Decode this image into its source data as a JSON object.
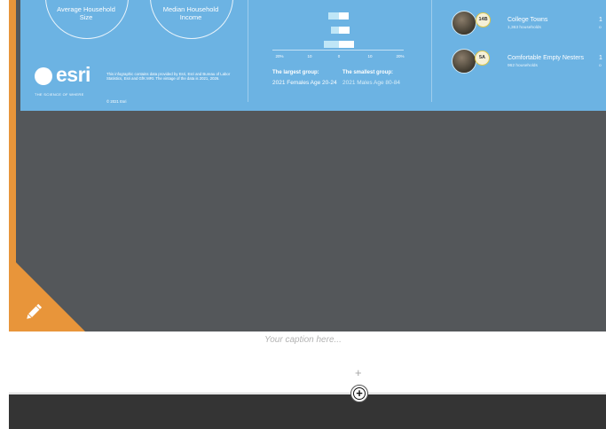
{
  "infographic": {
    "household_size_label": "Average Household Size",
    "income_label": "Median Household Income",
    "disclaimer": "This infographic contains data provided by Esri, Esri and Bureau of Labor Statistics, Esri and GfK MRI. The vintage of the data is 2021, 2026.",
    "copyright": "© 2021 Esri",
    "logo_text": "esri",
    "logo_tagline": "THE SCIENCE OF WHERE",
    "axis_ticks": [
      "20%",
      "10",
      "0",
      "10",
      "20%"
    ],
    "largest_group_label": "The largest group:",
    "largest_group_value": "2021 Females Age 20-24",
    "smallest_group_label": "The smallest group:",
    "smallest_group_value": "2021 Males Age 80-84",
    "segments": [
      {
        "badge": "14B",
        "name": "College Towns",
        "count": "1,363 households",
        "edge": "1",
        "edge_small": "o"
      },
      {
        "badge": "5A",
        "name": "Comfortable Empty Nesters",
        "count": "962 households",
        "edge": "1",
        "edge_small": "o"
      }
    ]
  },
  "caption": {
    "placeholder": "Your caption here..."
  },
  "controls": {
    "add_small": "+",
    "add_circle": "+"
  },
  "colors": {
    "accent": "#e8953a",
    "infographic_bg": "#6cb3e3",
    "frame_bg": "#54575a",
    "bottom_bar": "#343434"
  }
}
